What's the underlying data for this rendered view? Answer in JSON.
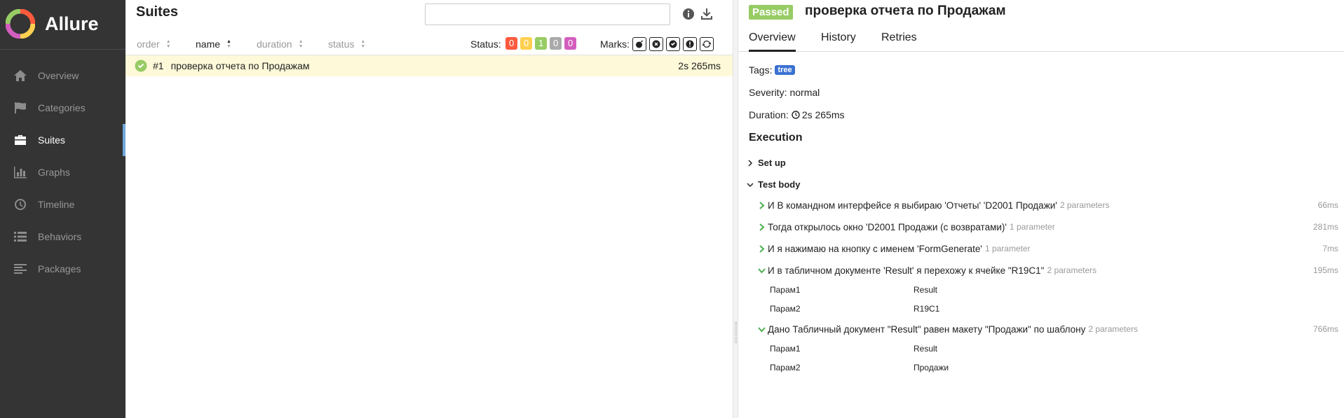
{
  "app": {
    "name": "Allure"
  },
  "sidebar": {
    "items": [
      {
        "label": "Overview",
        "icon": "home-icon",
        "active": false
      },
      {
        "label": "Categories",
        "icon": "flag-icon",
        "active": false
      },
      {
        "label": "Suites",
        "icon": "briefcase-icon",
        "active": true
      },
      {
        "label": "Graphs",
        "icon": "bar-chart-icon",
        "active": false
      },
      {
        "label": "Timeline",
        "icon": "clock-icon",
        "active": false
      },
      {
        "label": "Behaviors",
        "icon": "list-icon",
        "active": false
      },
      {
        "label": "Packages",
        "icon": "align-left-icon",
        "active": false
      }
    ]
  },
  "suites": {
    "title": "Suites",
    "search": {
      "value": "",
      "placeholder": ""
    },
    "columns": {
      "order": "order",
      "name": "name",
      "duration": "duration",
      "status": "status"
    },
    "status_label": "Status:",
    "status_counts": [
      {
        "status": "failed",
        "value": "0",
        "color": "#fd5a3e"
      },
      {
        "status": "broken",
        "value": "0",
        "color": "#ffd050"
      },
      {
        "status": "passed",
        "value": "1",
        "color": "#97cc64"
      },
      {
        "status": "skipped",
        "value": "0",
        "color": "#aaaaaa"
      },
      {
        "status": "unknown",
        "value": "0",
        "color": "#d35ebe"
      }
    ],
    "marks_label": "Marks:",
    "marks": [
      "bomb-icon",
      "close-icon",
      "check-icon",
      "exclamation-icon",
      "refresh-icon"
    ],
    "rows": [
      {
        "num": "#1",
        "name": "проверка отчета по Продажам",
        "duration": "2s 265ms",
        "status": "passed"
      }
    ]
  },
  "detail": {
    "status": "Passed",
    "title": "проверка отчета по Продажам",
    "tabs": [
      "Overview",
      "History",
      "Retries"
    ],
    "tags_label": "Tags:",
    "tag": "tree",
    "severity_label": "Severity:",
    "severity": "normal",
    "duration_label": "Duration:",
    "duration": "2s 265ms",
    "execution_title": "Execution",
    "setup_label": "Set up",
    "testbody_label": "Test body",
    "steps": [
      {
        "name": "И В командном интерфейсе я выбираю 'Отчеты' 'D2001 Продажи'",
        "params": "2 parameters",
        "duration": "66ms",
        "expanded": false,
        "param_rows": []
      },
      {
        "name": "Тогда открылось окно 'D2001 Продажи (с возвратами)'",
        "params": "1 parameter",
        "duration": "281ms",
        "expanded": false,
        "param_rows": []
      },
      {
        "name": "И я нажимаю на кнопку с именем 'FormGenerate'",
        "params": "1 parameter",
        "duration": "7ms",
        "expanded": false,
        "param_rows": []
      },
      {
        "name": "И в табличном документе 'Result' я перехожу к ячейке \"R19C1\"",
        "params": "2 parameters",
        "duration": "195ms",
        "expanded": true,
        "param_rows": [
          {
            "name": "Парам1",
            "value": "Result"
          },
          {
            "name": "Парам2",
            "value": "R19C1"
          }
        ]
      },
      {
        "name": "Дано Табличный документ \"Result\" равен макету \"Продажи\" по шаблону",
        "params": "2 parameters",
        "duration": "766ms",
        "expanded": true,
        "param_rows": [
          {
            "name": "Парам1",
            "value": "Result"
          },
          {
            "name": "Парам2",
            "value": "Продажи"
          }
        ]
      }
    ]
  }
}
